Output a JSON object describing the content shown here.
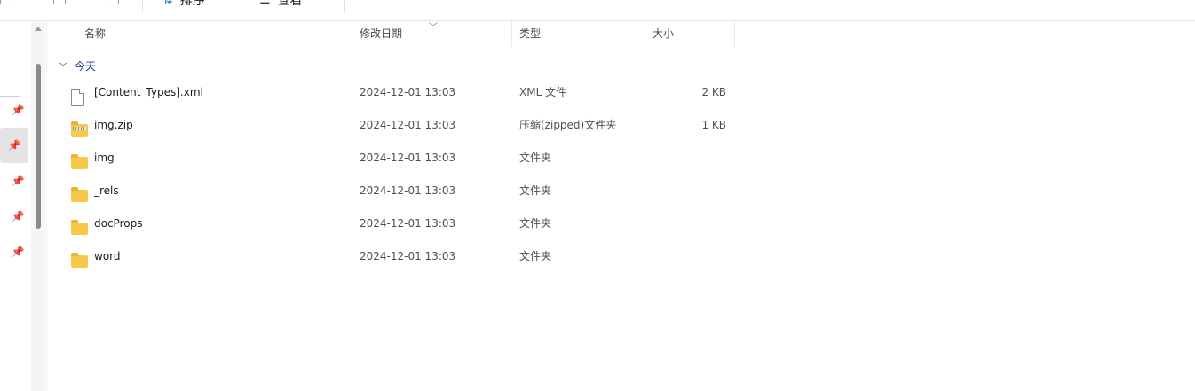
{
  "toolbar": {
    "sort_label": "排序",
    "view_label": "查看",
    "sort_icon": "sort-arrows-icon",
    "view_icon": "view-lines-icon"
  },
  "columns": {
    "name": "名称",
    "date": "修改日期",
    "type": "类型",
    "size": "大小"
  },
  "group": {
    "title": "今天"
  },
  "files": [
    {
      "name": "[Content_Types].xml",
      "date": "2024-12-01 13:03",
      "type": "XML 文件",
      "size": "2 KB",
      "icon": "document-icon"
    },
    {
      "name": "img.zip",
      "date": "2024-12-01 13:03",
      "type": "压缩(zipped)文件夹",
      "size": "1 KB",
      "icon": "zip-folder-icon"
    },
    {
      "name": "img",
      "date": "2024-12-01 13:03",
      "type": "文件夹",
      "size": "",
      "icon": "folder-icon"
    },
    {
      "name": "_rels",
      "date": "2024-12-01 13:03",
      "type": "文件夹",
      "size": "",
      "icon": "folder-icon"
    },
    {
      "name": "docProps",
      "date": "2024-12-01 13:03",
      "type": "文件夹",
      "size": "",
      "icon": "folder-icon"
    },
    {
      "name": "word",
      "date": "2024-12-01 13:03",
      "type": "文件夹",
      "size": "",
      "icon": "folder-icon"
    }
  ],
  "colors": {
    "folder": "#f7c948",
    "group_title": "#1f3d8a",
    "accent": "#2b66c7"
  }
}
